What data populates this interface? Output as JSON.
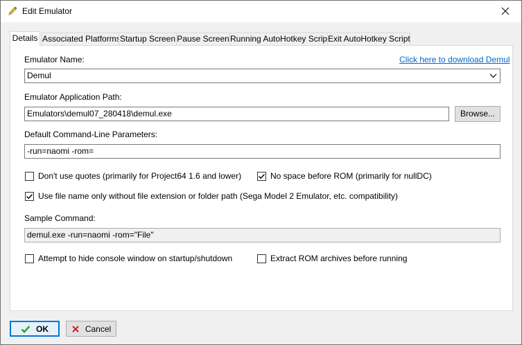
{
  "window": {
    "title": "Edit Emulator"
  },
  "tabs": [
    {
      "label": "Details",
      "active": true
    },
    {
      "label": "Associated Platforms"
    },
    {
      "label": "Startup Screen"
    },
    {
      "label": "Pause Screen"
    },
    {
      "label": "Running AutoHotkey Script"
    },
    {
      "label": "Exit AutoHotkey Script"
    }
  ],
  "details": {
    "emulator_name_label": "Emulator Name:",
    "download_link": "Click here to download Demul",
    "emulator_name_value": "Demul",
    "app_path_label": "Emulator Application Path:",
    "app_path_value": "Emulators\\demul07_280418\\demul.exe",
    "browse_label": "Browse...",
    "cmdline_label": "Default Command-Line Parameters:",
    "cmdline_value": "-run=naomi -rom=",
    "no_quotes": {
      "label": "Don't use quotes (primarily for Project64 1.6 and lower)",
      "checked": false
    },
    "no_space": {
      "label": "No space before ROM (primarily for nullDC)",
      "checked": true
    },
    "file_name_only": {
      "label": "Use file name only without file extension or folder path (Sega Model 2 Emulator, etc. compatibility)",
      "checked": true
    },
    "sample_label": "Sample Command:",
    "sample_value": "demul.exe -run=naomi -rom=\"File\"",
    "hide_console": {
      "label": "Attempt to hide console window on startup/shutdown",
      "checked": false
    },
    "extract_rom": {
      "label": "Extract ROM archives before running",
      "checked": false
    }
  },
  "footer": {
    "ok_label": "OK",
    "cancel_label": "Cancel"
  },
  "colors": {
    "link": "#0066cc",
    "focus_border": "#0078d7",
    "ok_check": "#2e9e2e",
    "cancel_x": "#cc2222"
  }
}
